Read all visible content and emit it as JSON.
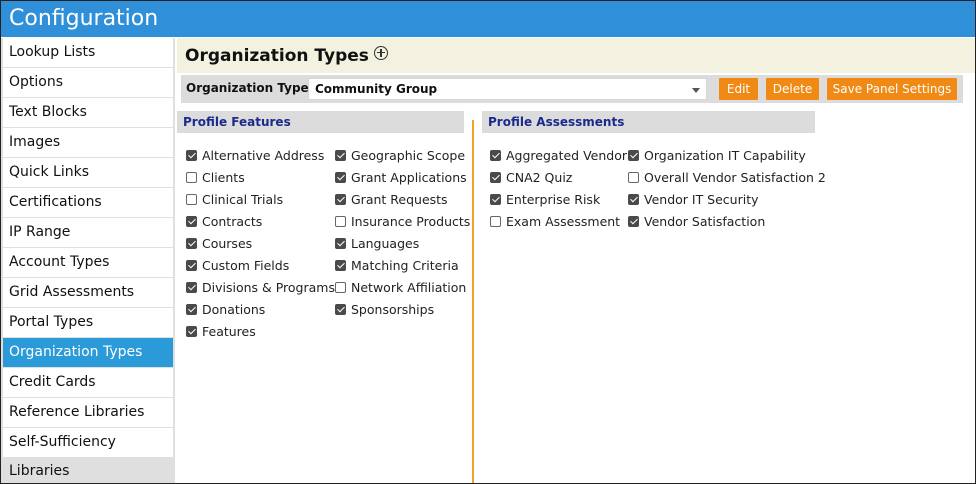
{
  "app": {
    "title": "Configuration"
  },
  "sidebar": {
    "items": [
      {
        "label": "Lookup Lists"
      },
      {
        "label": "Options"
      },
      {
        "label": "Text Blocks"
      },
      {
        "label": "Images"
      },
      {
        "label": "Quick Links"
      },
      {
        "label": "Certifications"
      },
      {
        "label": "IP Range"
      },
      {
        "label": "Account Types"
      },
      {
        "label": "Grid Assessments"
      },
      {
        "label": "Portal Types"
      },
      {
        "label": "Organization Types",
        "active": true
      },
      {
        "label": "Credit Cards"
      },
      {
        "label": "Reference Libraries"
      },
      {
        "label": "Self-Sufficiency Libraries"
      }
    ]
  },
  "header": {
    "title": "Organization Types",
    "icon": "plus-circle-icon"
  },
  "toolbar": {
    "org_type_label": "Organization Type:",
    "org_type_value": "Community Group",
    "edit_label": "Edit",
    "delete_label": "Delete",
    "save_label": "Save Panel Settings",
    "button_color": "#f08a15"
  },
  "profile_features": {
    "title": "Profile Features",
    "col1": [
      {
        "label": "Alternative Address",
        "checked": true
      },
      {
        "label": "Clients",
        "checked": false
      },
      {
        "label": "Clinical Trials",
        "checked": false
      },
      {
        "label": "Contracts",
        "checked": true
      },
      {
        "label": "Courses",
        "checked": true
      },
      {
        "label": "Custom Fields",
        "checked": true
      },
      {
        "label": "Divisions & Programs",
        "checked": true
      },
      {
        "label": "Donations",
        "checked": true
      },
      {
        "label": "Features",
        "checked": true
      }
    ],
    "col2": [
      {
        "label": "Geographic Scope",
        "checked": true
      },
      {
        "label": "Grant Applications",
        "checked": true
      },
      {
        "label": "Grant Requests",
        "checked": true
      },
      {
        "label": "Insurance Products",
        "checked": false
      },
      {
        "label": "Languages",
        "checked": true
      },
      {
        "label": "Matching Criteria",
        "checked": true
      },
      {
        "label": "Network Affiliation",
        "checked": false
      },
      {
        "label": "Sponsorships",
        "checked": true
      }
    ]
  },
  "profile_assessments": {
    "title": "Profile Assessments",
    "col1": [
      {
        "label": "Aggregated Vendor",
        "checked": true
      },
      {
        "label": "CNA2 Quiz",
        "checked": true
      },
      {
        "label": "Enterprise Risk",
        "checked": true
      },
      {
        "label": "Exam Assessment",
        "checked": false
      }
    ],
    "col2": [
      {
        "label": "Organization IT Capability",
        "checked": true
      },
      {
        "label": "Overall Vendor Satisfaction 2",
        "checked": false
      },
      {
        "label": "Vendor IT Security",
        "checked": true
      },
      {
        "label": "Vendor Satisfaction",
        "checked": true
      }
    ]
  },
  "colors": {
    "titlebar": "#2f8fd8",
    "active_item": "#2a9ad9",
    "divider": "#f0a22a",
    "section_title": "#1b2b8c"
  }
}
